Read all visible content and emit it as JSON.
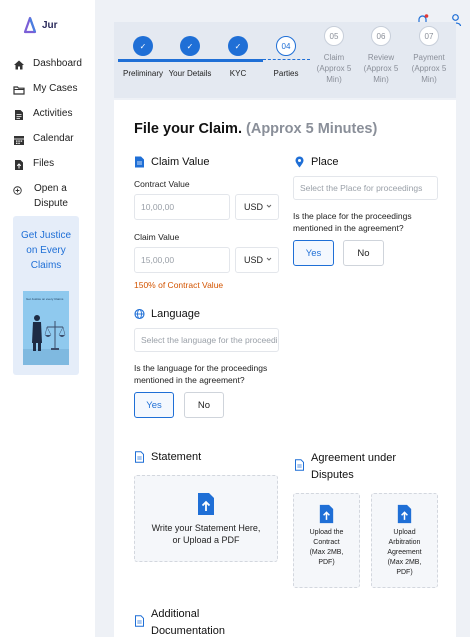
{
  "brand": {
    "name": "Jur"
  },
  "nav": [
    {
      "label": "Dashboard",
      "icon": "home-icon"
    },
    {
      "label": "My Cases",
      "icon": "folder-icon"
    },
    {
      "label": "Activities",
      "icon": "document-icon"
    },
    {
      "label": "Calendar",
      "icon": "calendar-icon"
    },
    {
      "label": "Files",
      "icon": "file-upload-icon"
    },
    {
      "label": "Open a Dispute",
      "icon": "plus-circle-icon"
    }
  ],
  "promo": {
    "text": "Get Justice on Every Claims",
    "image_caption": "Get Justice on every Claims"
  },
  "stepper": [
    {
      "label": "Preliminary",
      "state": "done"
    },
    {
      "label": "Your Details",
      "state": "done"
    },
    {
      "label": "KYC",
      "state": "done"
    },
    {
      "number": "04",
      "label": "Parties",
      "state": "active"
    },
    {
      "number": "05",
      "label": "Claim (Approx 5 Min)",
      "state": "todo"
    },
    {
      "number": "06",
      "label": "Review (Approx 5 Min)",
      "state": "todo"
    },
    {
      "number": "07",
      "label": "Payment (Approx 5 Min)",
      "state": "todo"
    }
  ],
  "form": {
    "title": "File your Claim.",
    "title_sub": "(Approx 5 Minutes)",
    "claim_value": {
      "heading": "Claim Value",
      "contract_label": "Contract Value",
      "contract_placeholder": "10,00,00",
      "contract_currency": "USD",
      "claim_label": "Claim Value",
      "claim_placeholder": "15,00,00",
      "claim_currency": "USD",
      "hint": "150% of Contract Value"
    },
    "place": {
      "heading": "Place",
      "placeholder": "Select the Place for proceedings",
      "question": "Is the place for the proceedings mentioned in the agreement?",
      "yes": "Yes",
      "no": "No"
    },
    "language": {
      "heading": "Language",
      "placeholder": "Select the language for the proceedings",
      "question": "Is the language for the proceedings mentioned in the agreement?",
      "yes": "Yes",
      "no": "No"
    },
    "statement": {
      "heading": "Statement",
      "drop_text": "Write your Statement Here, or Upload a PDF"
    },
    "agreement": {
      "heading": "Agreement under Disputes",
      "upload_contract": "Upload the Contract",
      "upload_contract_note": "(Max 2MB, PDF)",
      "upload_arbitration": "Upload Arbitration Agreement",
      "upload_arbitration_note": "(Max 2MB, PDF)"
    },
    "additional": {
      "heading": "Additional Documentation"
    }
  },
  "colors": {
    "accent": "#1f6fd6",
    "hint": "#d35400",
    "brand": "#7b5fd6"
  }
}
